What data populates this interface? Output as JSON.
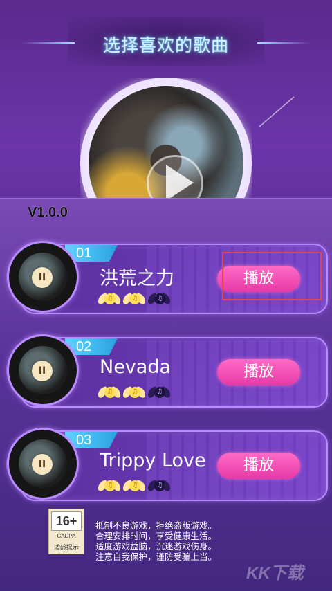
{
  "header": {
    "title": "选择喜欢的歌曲"
  },
  "version": "V1.0.0",
  "songs": [
    {
      "number": "01",
      "name": "洪荒之力",
      "play_label": "播放",
      "pause_icon": "pause-icon",
      "rating": [
        "gold",
        "gold",
        "dark"
      ]
    },
    {
      "number": "02",
      "name": "Nevada",
      "play_label": "播放",
      "pause_icon": "pause-icon",
      "rating": [
        "gold",
        "gold",
        "dark"
      ]
    },
    {
      "number": "03",
      "name": "Trippy Love",
      "play_label": "播放",
      "pause_icon": "pause-icon",
      "rating": [
        "gold",
        "gold",
        "dark"
      ]
    }
  ],
  "age_badge": {
    "age": "16+",
    "org": "CADPA",
    "label": "适龄提示"
  },
  "notice": [
    "抵制不良游戏，拒绝盗版游戏。",
    "合理安排时间，享受健康生活。",
    "适度游戏益脑，沉迷游戏伤身。",
    "注意自我保护，谨防受骗上当。"
  ],
  "watermark": "KK下载",
  "colors": {
    "accent_pink": "#e63aa7",
    "tab_blue": "#2b9fe0",
    "highlight_red": "#e0474b"
  }
}
